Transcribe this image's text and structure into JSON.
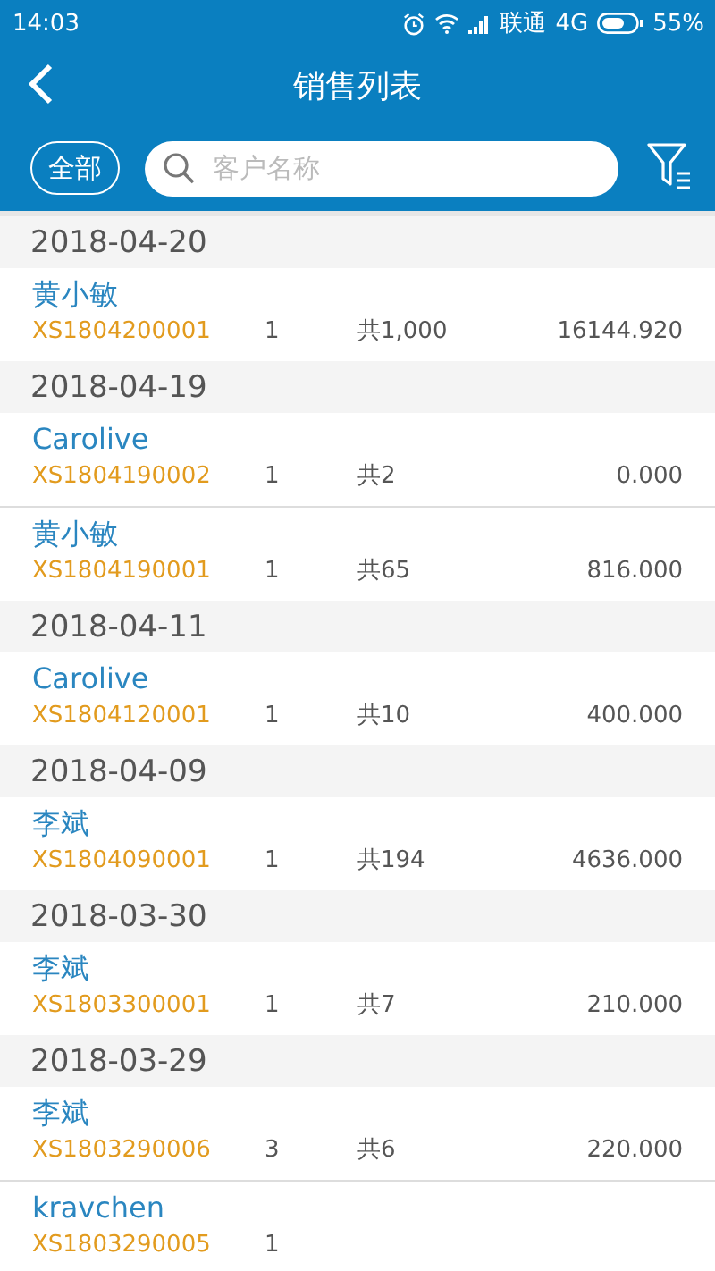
{
  "status_bar": {
    "time": "14:03",
    "carrier": "联通",
    "network": "4G",
    "battery": "55%"
  },
  "header": {
    "title": "销售列表"
  },
  "toolbar": {
    "scope_button": "全部",
    "search": {
      "placeholder": "客户名称"
    }
  },
  "groups": [
    {
      "date": "2018-04-20",
      "orders": [
        {
          "customer": "黄小敏",
          "code": "XS1804200001",
          "count": "1",
          "quantity": "共1,000",
          "amount": "16144.920"
        }
      ]
    },
    {
      "date": "2018-04-19",
      "orders": [
        {
          "customer": "Carolive",
          "code": "XS1804190002",
          "count": "1",
          "quantity": "共2",
          "amount": "0.000"
        },
        {
          "customer": "黄小敏",
          "code": "XS1804190001",
          "count": "1",
          "quantity": "共65",
          "amount": "816.000"
        }
      ]
    },
    {
      "date": "2018-04-11",
      "orders": [
        {
          "customer": "Carolive",
          "code": "XS1804120001",
          "count": "1",
          "quantity": "共10",
          "amount": "400.000"
        }
      ]
    },
    {
      "date": "2018-04-09",
      "orders": [
        {
          "customer": "李斌",
          "code": "XS1804090001",
          "count": "1",
          "quantity": "共194",
          "amount": "4636.000"
        }
      ]
    },
    {
      "date": "2018-03-30",
      "orders": [
        {
          "customer": "李斌",
          "code": "XS1803300001",
          "count": "1",
          "quantity": "共7",
          "amount": "210.000"
        }
      ]
    },
    {
      "date": "2018-03-29",
      "orders": [
        {
          "customer": "李斌",
          "code": "XS1803290006",
          "count": "3",
          "quantity": "共6",
          "amount": "220.000"
        },
        {
          "customer": "kravchen",
          "code": "XS1803290005",
          "count": "1"
        }
      ]
    }
  ]
}
